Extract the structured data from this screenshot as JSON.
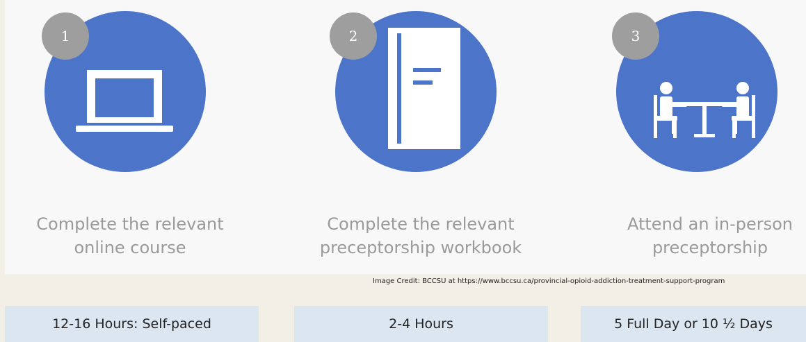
{
  "steps": [
    {
      "number": "1",
      "icon": "laptop-icon",
      "caption_line1": "Complete the relevant",
      "caption_line2": "online course"
    },
    {
      "number": "2",
      "icon": "workbook-icon",
      "caption_line1": "Complete the relevant",
      "caption_line2": "preceptorship workbook"
    },
    {
      "number": "3",
      "icon": "meeting-icon",
      "caption_line1": "Attend an in-person",
      "caption_line2": "preceptorship"
    }
  ],
  "credit": "Image Credit: BCCSU at https://www.bccsu.ca/provincial-opioid-addiction-treatment-support-program",
  "durations": [
    "12-16 Hours: Self-paced",
    "2-4 Hours",
    "5 Full Day or 10 ½ Days"
  ],
  "colors": {
    "circle": "#4c74c9",
    "badge": "#9e9e9e",
    "caption": "#9a9a9a",
    "duration_box": "#dce6f1",
    "background": "#f1efe6"
  }
}
